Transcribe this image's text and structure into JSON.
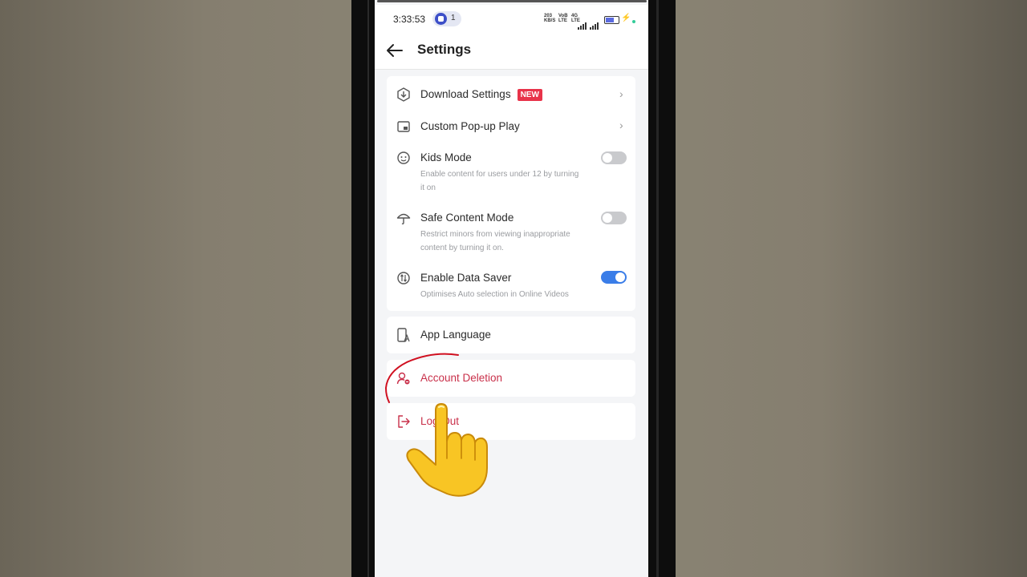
{
  "status_bar": {
    "time": "3:33:53",
    "notification_count": "1",
    "net_speed_value": "203",
    "net_speed_unit": "KB/S",
    "sim1_label_top": "VoB",
    "sim1_label_bottom": "LTE",
    "sim2_label_top": "4G",
    "sim2_label_bottom": "LTE"
  },
  "header": {
    "title": "Settings",
    "back_icon": "arrow-left-icon"
  },
  "settings_group": [
    {
      "id": "download",
      "icon": "download-shield-icon",
      "label": "Download Settings",
      "badge": "NEW",
      "control": "chevron"
    },
    {
      "id": "popup",
      "icon": "picture-in-picture-icon",
      "label": "Custom Pop-up Play",
      "control": "chevron"
    },
    {
      "id": "kids",
      "icon": "kids-face-icon",
      "label": "Kids Mode",
      "description": "Enable content for users under 12 by turning it on",
      "toggle": false
    },
    {
      "id": "safe",
      "icon": "umbrella-icon",
      "label": "Safe Content Mode",
      "description": "Restrict minors from viewing inappropriate content by turning it on.",
      "toggle": false
    },
    {
      "id": "datasaver",
      "icon": "data-saver-icon",
      "label": "Enable Data Saver",
      "description": "Optimises Auto selection in Online Videos",
      "toggle": true
    }
  ],
  "app_language": {
    "icon": "language-phone-icon",
    "label": "App Language"
  },
  "account_deletion": {
    "icon": "user-remove-icon",
    "label": "Account Deletion"
  },
  "logout": {
    "icon": "logout-icon",
    "label": "Log Out"
  },
  "colors": {
    "accent_blue": "#3a7de8",
    "danger_red": "#c9304a",
    "badge_red": "#e8334a",
    "screen_bg": "#f4f5f7"
  }
}
